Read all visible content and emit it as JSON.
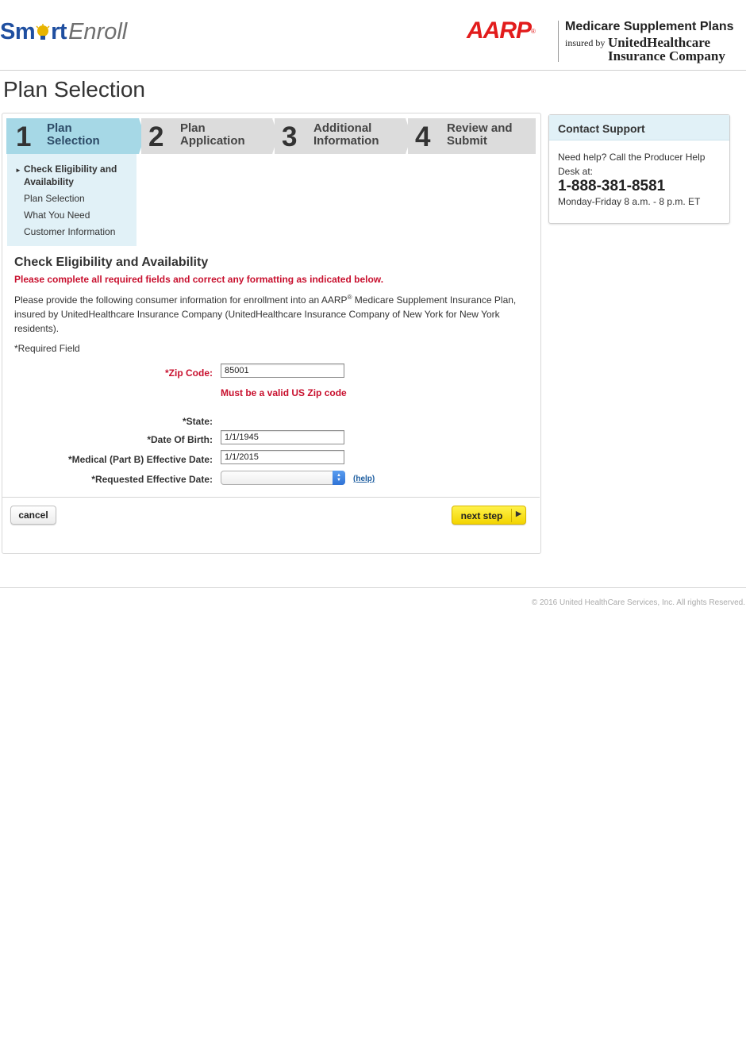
{
  "header": {
    "logo_smart": "Sm",
    "logo_rt": "rt",
    "logo_enroll": "Enroll",
    "aarp": "AARP",
    "brand_title": "Medicare Supplement Plans",
    "insured_by": "insured by",
    "uhc": "UnitedHealthcare",
    "insurance_company": "Insurance Company"
  },
  "page_title": "Plan Selection",
  "steps": [
    {
      "number": "1",
      "label_line1": "Plan",
      "label_line2": "Selection",
      "active": true
    },
    {
      "number": "2",
      "label_line1": "Plan",
      "label_line2": "Application",
      "active": false
    },
    {
      "number": "3",
      "label_line1": "Additional",
      "label_line2": "Information",
      "active": false
    },
    {
      "number": "4",
      "label_line1": "Review and",
      "label_line2": "Submit",
      "active": false
    }
  ],
  "substeps": [
    {
      "label_line1": "Check Eligibility and",
      "label_line2": "Availability",
      "current": true
    },
    {
      "label_line1": "Plan Selection",
      "current": false
    },
    {
      "label_line1": "What You Need",
      "current": false
    },
    {
      "label_line1": "Customer Information",
      "current": false
    }
  ],
  "section": {
    "title": "Check Eligibility and Availability",
    "error": "Please complete all required fields and correct any formatting as indicated below.",
    "intro_line1_a": "Please provide the following consumer information for enrollment into an AARP",
    "intro_reg": "®",
    "intro_line1_b": " Medicare Supplement Insurance Plan,",
    "intro_line2": "insured by UnitedHealthcare Insurance Company (UnitedHealthcare Insurance Company of New York for New York",
    "intro_line3": "residents).",
    "required_note": "*Required Field"
  },
  "form": {
    "zip_label": "*Zip Code:",
    "zip_value": "85001",
    "zip_error": "Must be a valid US Zip code",
    "state_label": "*State:",
    "dob_label": "*Date Of Birth:",
    "dob_value": "1/1/1945",
    "partb_label": "*Medical (Part B) Effective Date:",
    "partb_value": "1/1/2015",
    "requested_label": "*Requested Effective Date:",
    "requested_value": "",
    "help_link": "(help)"
  },
  "buttons": {
    "cancel": "cancel",
    "next": "next step"
  },
  "support": {
    "title": "Contact Support",
    "text": "Need help? Call the Producer Help Desk at:",
    "phone": "1-888-381-8581",
    "hours": "Monday-Friday 8 a.m. - 8 p.m. ET"
  },
  "footer": {
    "copyright": "© 2016 United HealthCare Services, Inc. All rights Reserved."
  },
  "colors": {
    "accent_blue": "#1f4fa0",
    "aarp_red": "#e21c1c",
    "error_red": "#c8102e",
    "active_step": "#a6d8e6",
    "inactive_step": "#dcdcdc",
    "next_button": "#f3d400"
  }
}
